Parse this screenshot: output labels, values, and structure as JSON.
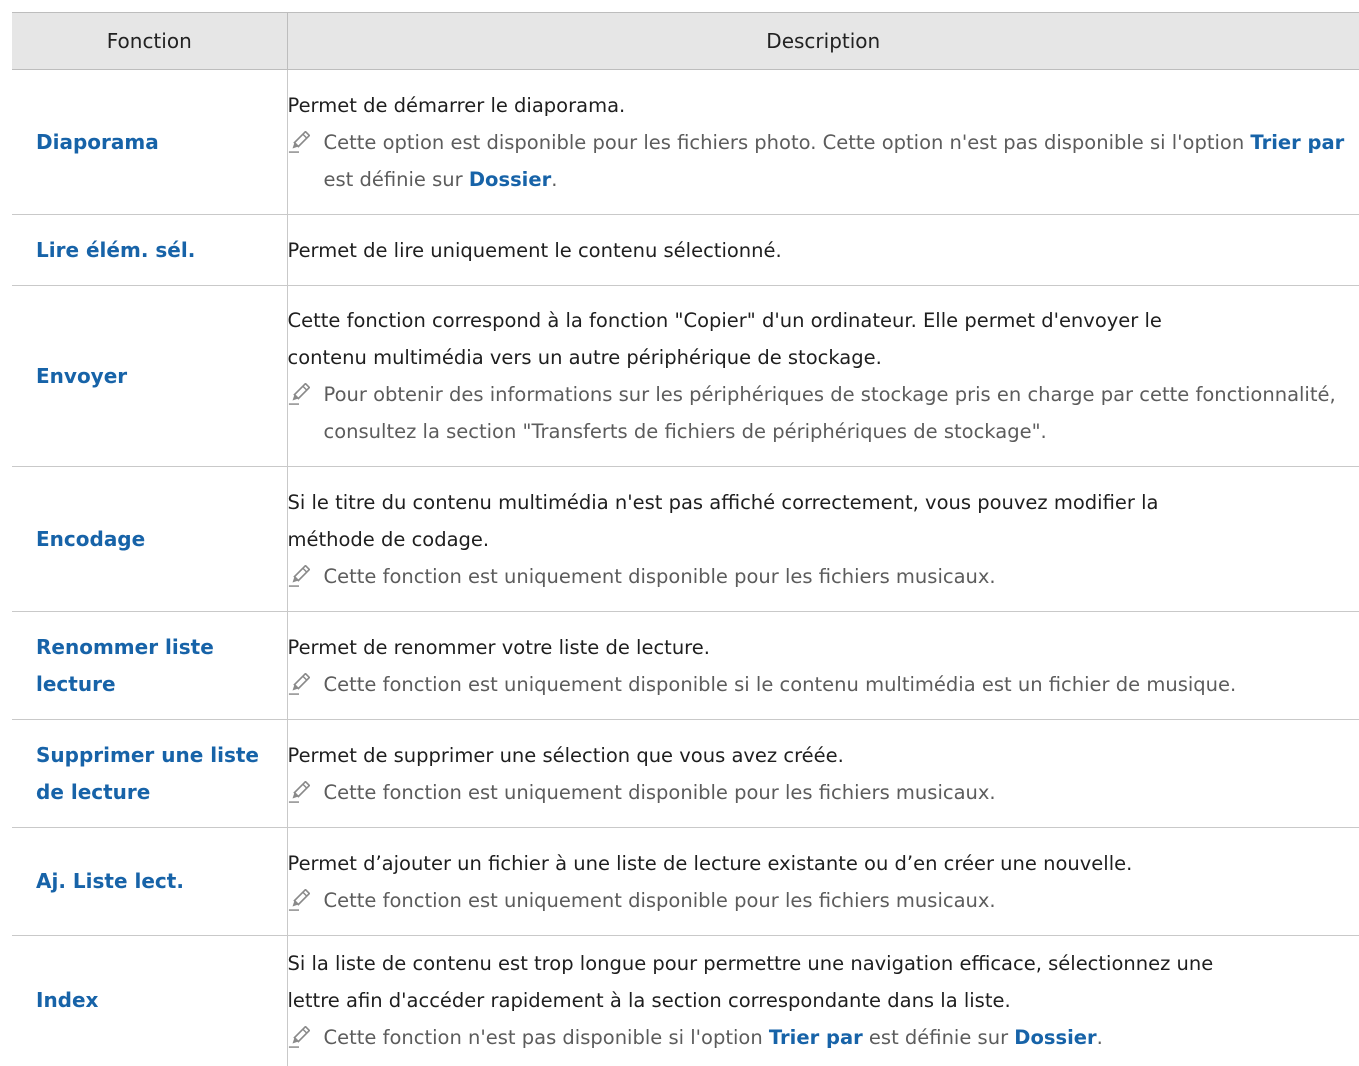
{
  "table": {
    "header": {
      "col_function": "Fonction",
      "col_description": "Description"
    },
    "rows": [
      {
        "function": "Diaporama",
        "desc": [
          "Permet de démarrer le diaporama."
        ],
        "note": {
          "pre": "Cette option est disponible pour les fichiers photo. Cette option n'est pas disponible si l'option ",
          "kw1": "Trier par",
          "mid": " est définie sur ",
          "kw2": "Dossier",
          "post": "."
        }
      },
      {
        "function": "Lire élém. sél.",
        "desc": [
          "Permet de lire uniquement le contenu sélectionné."
        ]
      },
      {
        "function": "Envoyer",
        "desc": [
          "Cette fonction correspond à la fonction \"Copier\" d'un ordinateur. Elle permet d'envoyer le",
          "contenu multimédia vers un autre périphérique de stockage."
        ],
        "note": {
          "text": "Pour obtenir des informations sur les périphériques de stockage pris en charge par cette fonctionnalité, consultez la section \"Transferts de fichiers de périphériques de stockage\"."
        }
      },
      {
        "function": "Encodage",
        "desc": [
          "Si le titre du contenu multimédia n'est pas affiché correctement, vous pouvez modifier la",
          "méthode de codage."
        ],
        "note": {
          "text": "Cette fonction est uniquement disponible pour les fichiers musicaux."
        }
      },
      {
        "function": "Renommer liste lecture",
        "desc": [
          "Permet de renommer votre liste de lecture."
        ],
        "note": {
          "text": "Cette fonction est uniquement disponible si le contenu multimédia est un fichier de musique."
        }
      },
      {
        "function": "Supprimer une liste de lecture",
        "desc": [
          "Permet de supprimer une sélection que vous avez créée."
        ],
        "note": {
          "text": "Cette fonction est uniquement disponible pour les fichiers musicaux."
        }
      },
      {
        "function": "Aj. Liste lect.",
        "desc": [
          "Permet d’ajouter un fichier à une liste de lecture existante ou d’en créer une nouvelle."
        ],
        "note": {
          "text": "Cette fonction est uniquement disponible pour les fichiers musicaux."
        }
      },
      {
        "function": "Index",
        "desc": [
          "Si la liste de contenu est trop longue pour permettre une navigation efficace, sélectionnez une",
          "lettre afin d'accéder rapidement à la section correspondante dans la liste."
        ],
        "note": {
          "pre": "Cette fonction n'est pas disponible si l'option ",
          "kw1": "Trier par",
          "mid": " est définie sur ",
          "kw2": "Dossier",
          "post": "."
        }
      }
    ]
  },
  "icons": {
    "note": "pencil-icon"
  },
  "colors": {
    "function_text": "#1763a8",
    "header_bg": "#e6e6e6",
    "note_text": "#5c5c5c",
    "body_text": "#1e1e1e",
    "border": "#c9c9c9"
  }
}
